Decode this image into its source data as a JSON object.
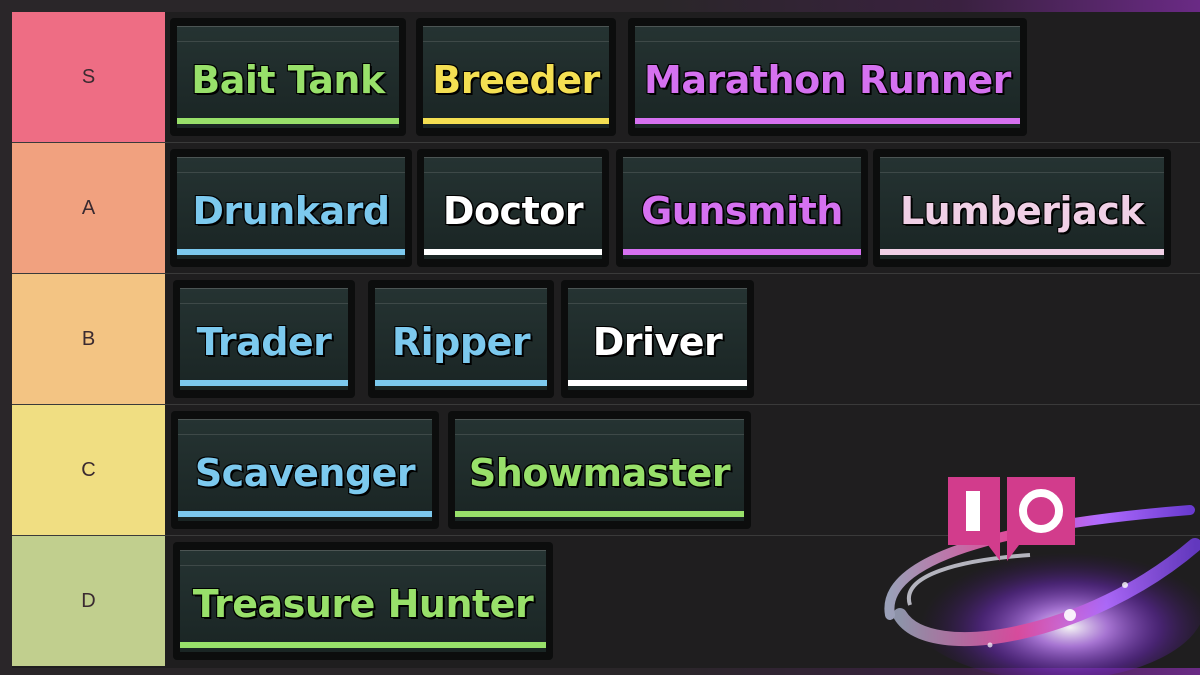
{
  "colors": {
    "green": "#98e06a",
    "yellow": "#f4df52",
    "purple": "#d571f0",
    "blue": "#7cc9ee",
    "white": "#ffffff",
    "pink": "#f0d0e6",
    "tier_s": "#ee6d84",
    "tier_a": "#f1a17f",
    "tier_b": "#f3c483",
    "tier_c": "#f0de82",
    "tier_d": "#c1cf8e"
  },
  "tiers": [
    {
      "label": "S",
      "items": [
        {
          "name": "Bait Tank",
          "color": "green"
        },
        {
          "name": "Breeder",
          "color": "yellow"
        },
        {
          "name": "Marathon Runner",
          "color": "purple"
        }
      ]
    },
    {
      "label": "A",
      "items": [
        {
          "name": "Drunkard",
          "color": "blue"
        },
        {
          "name": "Doctor",
          "color": "white"
        },
        {
          "name": "Gunsmith",
          "color": "purple"
        },
        {
          "name": "Lumberjack",
          "color": "pink"
        }
      ]
    },
    {
      "label": "B",
      "items": [
        {
          "name": "Trader",
          "color": "blue"
        },
        {
          "name": "Ripper",
          "color": "blue"
        },
        {
          "name": "Driver",
          "color": "white"
        }
      ]
    },
    {
      "label": "C",
      "items": [
        {
          "name": "Scavenger",
          "color": "blue"
        },
        {
          "name": "Showmaster",
          "color": "green"
        }
      ]
    },
    {
      "label": "D",
      "items": [
        {
          "name": "Treasure Hunter",
          "color": "green"
        }
      ]
    }
  ],
  "logo": {
    "icon": "io-logo-icon"
  }
}
